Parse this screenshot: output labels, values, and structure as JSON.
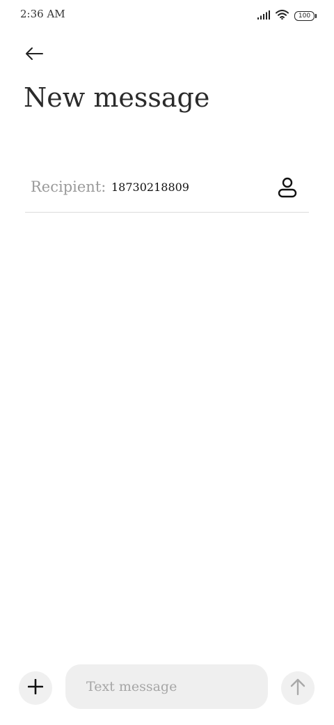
{
  "status_bar": {
    "time": "2:36 AM",
    "battery": "100",
    "icons": [
      "signal-icon",
      "wifi-icon",
      "battery-icon"
    ]
  },
  "header": {
    "back_icon": "arrow-left-icon",
    "title": "New message"
  },
  "recipient": {
    "label": "Recipient:",
    "value": "18730218809",
    "contact_icon": "person-icon"
  },
  "composer": {
    "add_icon": "plus-icon",
    "placeholder": "Text message",
    "send_icon": "arrow-up-icon"
  },
  "colors": {
    "background": "#ffffff",
    "title": "#2b2b2b",
    "label": "#9a9a9a",
    "divider": "#dcdcdc",
    "composer_bg": "#efefef",
    "send_icon_disabled": "#a8a8a8"
  }
}
